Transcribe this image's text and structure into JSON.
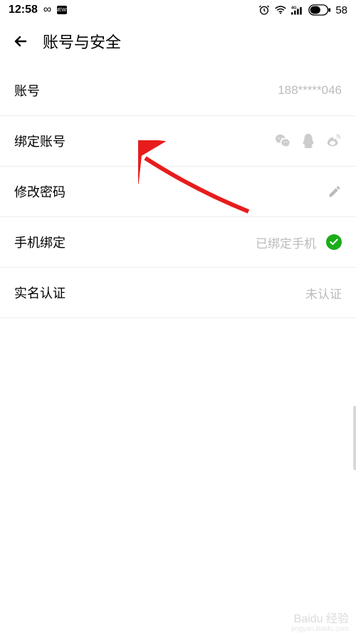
{
  "status_bar": {
    "time": "12:58",
    "battery": "58"
  },
  "header": {
    "title": "账号与安全"
  },
  "items": {
    "account": {
      "label": "账号",
      "value": "188*****046"
    },
    "bind_account": {
      "label": "绑定账号"
    },
    "change_password": {
      "label": "修改密码"
    },
    "phone_bind": {
      "label": "手机绑定",
      "status": "已绑定手机"
    },
    "real_name": {
      "label": "实名认证",
      "status": "未认证"
    }
  },
  "watermark": {
    "main": "Baidu 经验",
    "sub": "jingyan.baidu.com"
  }
}
